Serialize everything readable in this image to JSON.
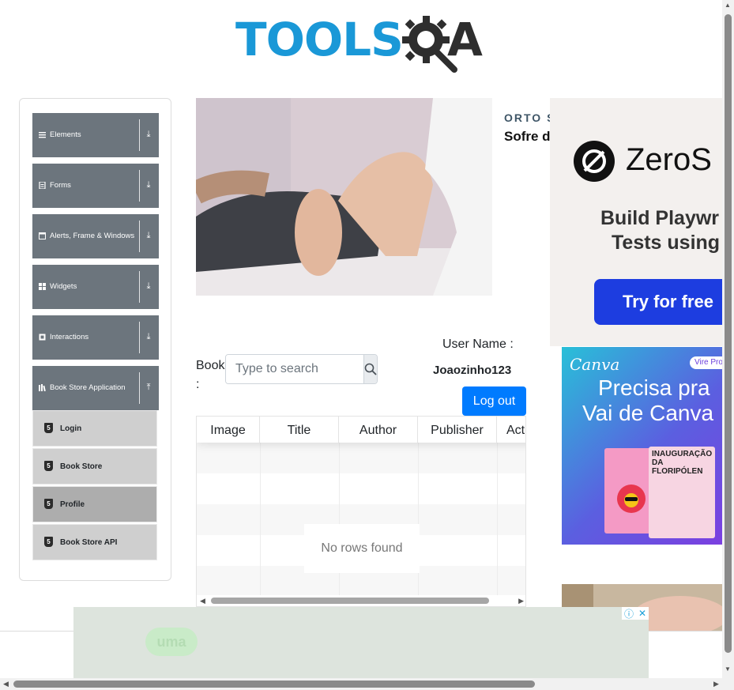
{
  "logo": {
    "text": "TOOLS",
    "suffix": "A"
  },
  "sidebar": {
    "groups": [
      {
        "label": "Elements",
        "icon": "menu-icon"
      },
      {
        "label": "Forms",
        "icon": "document-icon"
      },
      {
        "label": "Alerts, Frame & Windows",
        "icon": "window-icon"
      },
      {
        "label": "Widgets",
        "icon": "grid-icon"
      },
      {
        "label": "Interactions",
        "icon": "interactions-icon"
      },
      {
        "label": "Book Store Application",
        "icon": "books-icon"
      }
    ],
    "subitems": [
      {
        "label": "Login",
        "active": false
      },
      {
        "label": "Book Store",
        "active": false
      },
      {
        "label": "Profile",
        "active": true
      },
      {
        "label": "Book Store API",
        "active": false
      }
    ]
  },
  "ad_top": {
    "brand": "ORTO S",
    "title": "Sofre d"
  },
  "right_ad1": {
    "brand": "ZeroS",
    "headline_1": "Build Playwr",
    "headline_2": "Tests using",
    "cta": "Try for free"
  },
  "right_ad2": {
    "brand": "Canva",
    "badge": "Vire Pro",
    "headline_1": "Precisa pra",
    "headline_2": "Vai de Canva",
    "poster": "INAUGURAÇÃO DA FLORIPÓLEN"
  },
  "profile": {
    "search_label": "Book :",
    "search_placeholder": "Type to search",
    "username_label": "User Name :",
    "username_value": "Joaozinho123",
    "logout_label": "Log out"
  },
  "table": {
    "columns": [
      "Image",
      "Title",
      "Author",
      "Publisher",
      "Act"
    ],
    "empty_text": "No rows found"
  },
  "bottom_ad": {
    "pill_text": "uma"
  },
  "colors": {
    "sidebar_group": "#6c757d",
    "accent": "#007bff",
    "logo_blue": "#1a98d7"
  }
}
